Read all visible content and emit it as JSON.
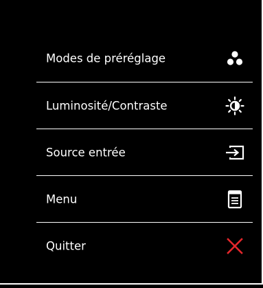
{
  "menu": {
    "items": [
      {
        "label": "Modes de préréglage",
        "icon": "preset-modes-icon"
      },
      {
        "label": "Luminosité/Contraste",
        "icon": "brightness-contrast-icon"
      },
      {
        "label": "Source entrée",
        "icon": "input-source-icon"
      },
      {
        "label": "Menu",
        "icon": "menu-icon"
      },
      {
        "label": "Quitter",
        "icon": "exit-icon"
      }
    ]
  },
  "colors": {
    "background": "#000000",
    "text": "#ffffff",
    "divider": "#ffffff",
    "exit_accent": "#e3262b"
  }
}
